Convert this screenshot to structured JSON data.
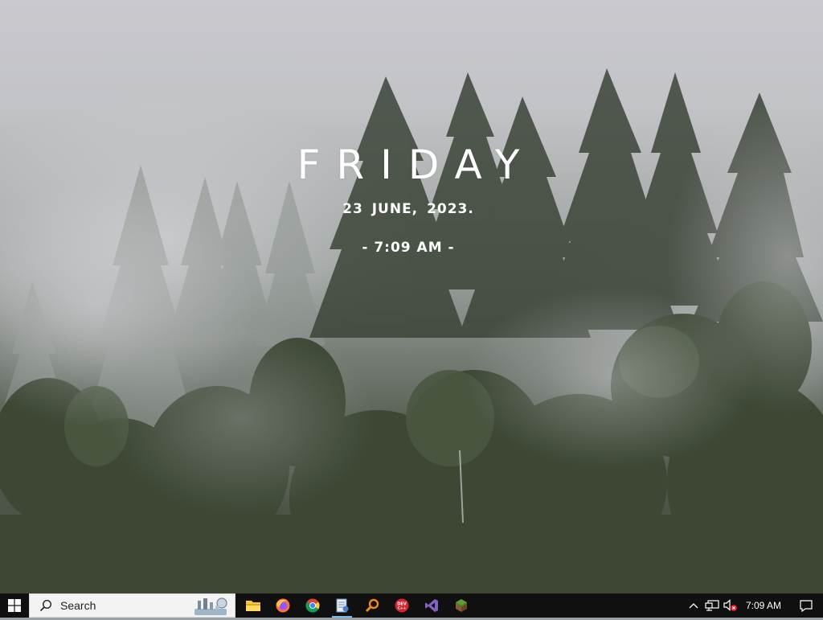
{
  "widget": {
    "day": "FRIDAY",
    "date": "23 JUNE, 2023.",
    "time": "- 7:09 AM -"
  },
  "taskbar": {
    "start_icon": "windows-logo-icon",
    "search_placeholder": "Search",
    "search_highlight_icon": "search-highlight-illustration-icon",
    "apps": [
      {
        "name": "file-explorer-icon",
        "running": false
      },
      {
        "name": "firefox-icon",
        "running": false
      },
      {
        "name": "chrome-icon",
        "running": false
      },
      {
        "name": "notepad-document-icon",
        "running": true
      },
      {
        "name": "search-tool-icon",
        "running": false
      },
      {
        "name": "dev-app-icon",
        "running": false
      },
      {
        "name": "visual-studio-icon",
        "running": false
      },
      {
        "name": "minecraft-icon",
        "running": false
      }
    ],
    "tray": {
      "overflow_icon": "chevron-up-icon",
      "network_icon": "network-icon",
      "volume_icon": "volume-muted-icon",
      "clock": "7:09 AM",
      "notifications_icon": "action-center-icon"
    }
  },
  "colors": {
    "taskbar_bg": "#101010",
    "search_bg": "#f3f3f3",
    "running_indicator": "#76b9ed"
  }
}
